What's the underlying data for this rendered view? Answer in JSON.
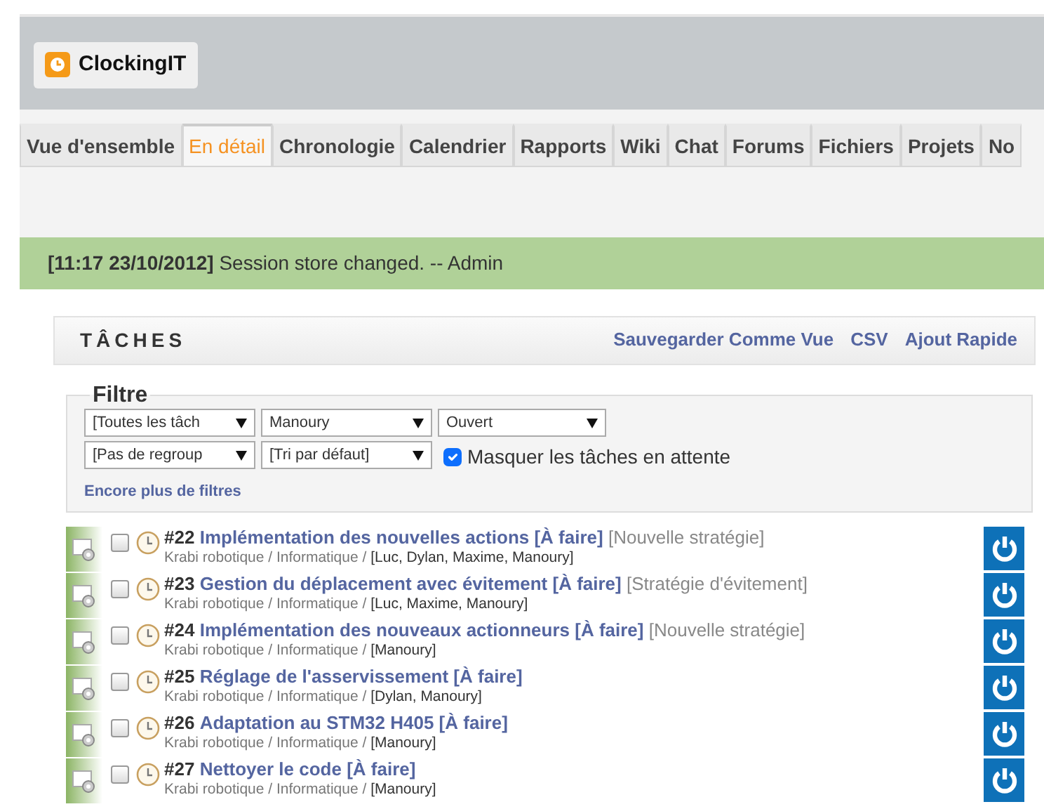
{
  "logo": {
    "text": "ClockingIT"
  },
  "tabs": [
    {
      "label": "Vue d'ensemble",
      "selected": false
    },
    {
      "label": "En détail",
      "selected": true
    },
    {
      "label": "Chronologie",
      "selected": false
    },
    {
      "label": "Calendrier",
      "selected": false
    },
    {
      "label": "Rapports",
      "selected": false
    },
    {
      "label": "Wiki",
      "selected": false
    },
    {
      "label": "Chat",
      "selected": false
    },
    {
      "label": "Forums",
      "selected": false
    },
    {
      "label": "Fichiers",
      "selected": false
    },
    {
      "label": "Projets",
      "selected": false
    },
    {
      "label": "No",
      "selected": false
    }
  ],
  "flash": {
    "time": "[11:17 23/10/2012]",
    "message": "Session store changed. -- Admin"
  },
  "tasks_panel": {
    "title": "TÂCHES",
    "links": [
      "Sauvegarder Comme Vue",
      "CSV",
      "Ajout Rapide"
    ]
  },
  "filter": {
    "legend": "Filtre",
    "selects": [
      [
        "[Toutes les tâch",
        "Manoury",
        "Ouvert"
      ],
      [
        "[Pas de regroup",
        "[Tri par défaut]"
      ]
    ],
    "hide_waiting": {
      "label": "Masquer les tâches en attente",
      "checked": true
    },
    "more_link": "Encore plus de filtres"
  },
  "tasks": [
    {
      "number": "#22",
      "title": "Implémentation des nouvelles actions [À faire]",
      "tag": "[Nouvelle stratégie]",
      "path": "Krabi robotique / Informatique / ",
      "people": "[Luc, Dylan, Maxime, Manoury]",
      "checked": false
    },
    {
      "number": "#23",
      "title": "Gestion du déplacement avec évitement [À faire]",
      "tag": "[Stratégie d'évitement]",
      "path": "Krabi robotique / Informatique / ",
      "people": "[Luc, Maxime, Manoury]",
      "checked": false
    },
    {
      "number": "#24",
      "title": "Implémentation des nouveaux actionneurs [À faire]",
      "tag": "[Nouvelle stratégie]",
      "path": "Krabi robotique / Informatique / ",
      "people": "[Manoury]",
      "checked": false
    },
    {
      "number": "#25",
      "title": "Réglage de l'asservissement [À faire]",
      "path": "Krabi robotique / Informatique / ",
      "people": "[Dylan, Manoury]",
      "checked": false
    },
    {
      "number": "#26",
      "title": "Adaptation au STM32 H405 [À faire]",
      "path": "Krabi robotique / Informatique / ",
      "people": "[Manoury]",
      "checked": false
    },
    {
      "number": "#27",
      "title": "Nettoyer le code [À faire]",
      "path": "Krabi robotique / Informatique / ",
      "people": "[Manoury]",
      "checked": false
    }
  ]
}
